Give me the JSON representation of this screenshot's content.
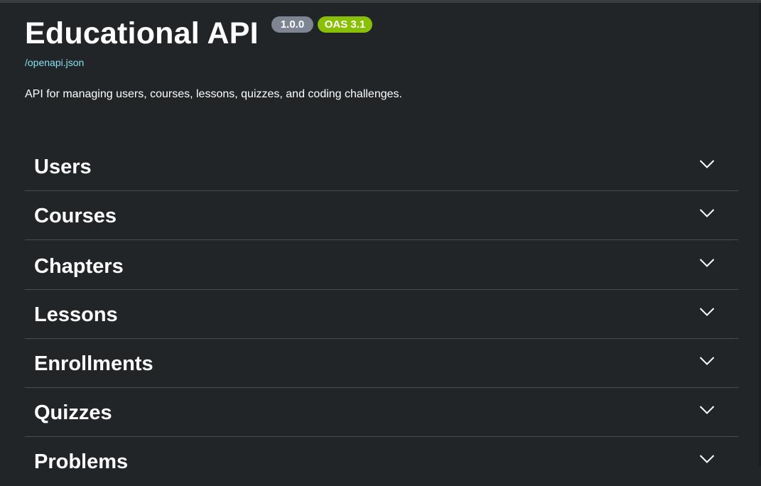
{
  "info": {
    "title": "Educational API",
    "version": "1.0.0",
    "oas_version": "OAS 3.1",
    "spec_link": "/openapi.json",
    "description": "API for managing users, courses, lessons, quizzes, and coding challenges."
  },
  "tags": [
    {
      "label": "Users",
      "icon": "chevron-down-icon"
    },
    {
      "label": "Courses",
      "icon": "chevron-down-icon"
    },
    {
      "label": "Chapters",
      "icon": "chevron-down-icon"
    },
    {
      "label": "Lessons",
      "icon": "chevron-down-icon"
    },
    {
      "label": "Enrollments",
      "icon": "chevron-down-icon"
    },
    {
      "label": "Quizzes",
      "icon": "chevron-down-icon"
    },
    {
      "label": "Problems",
      "icon": "chevron-down-icon"
    }
  ],
  "colors": {
    "background": "#222527",
    "version_badge": "#7d8492",
    "oas_badge": "#89bf04",
    "link": "#86e0f2",
    "divider": "#4a4d50"
  }
}
